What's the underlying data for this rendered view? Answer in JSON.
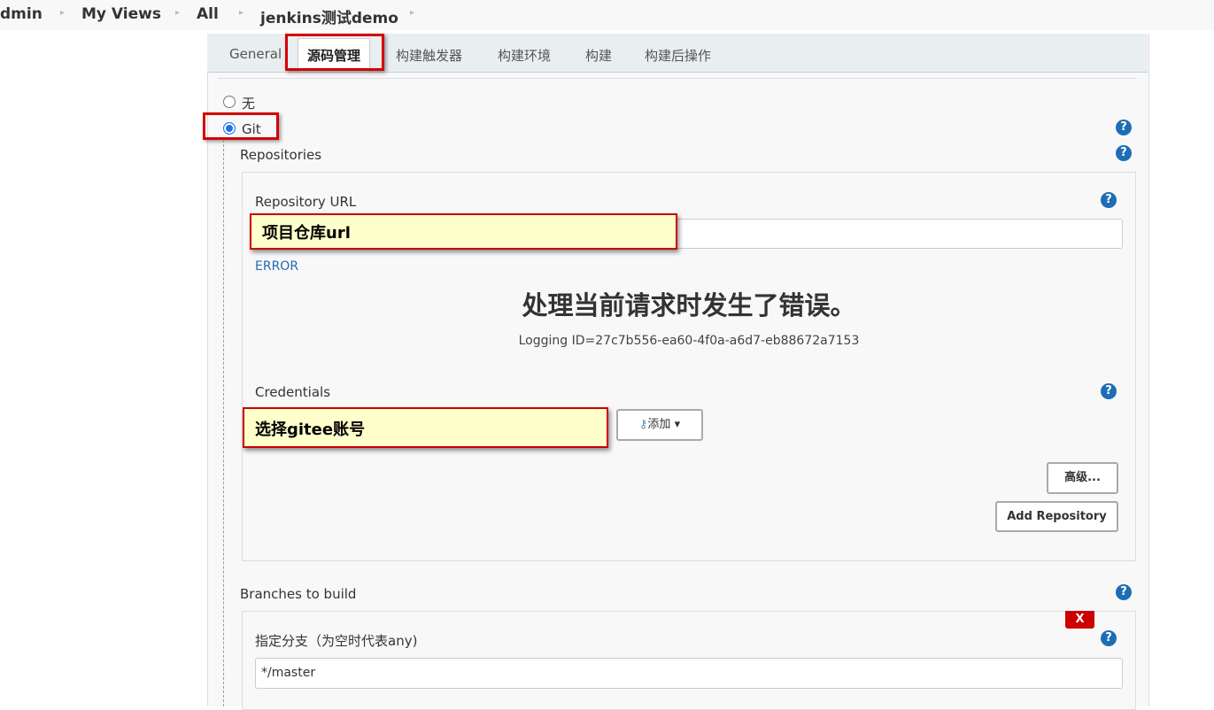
{
  "breadcrumbs": [
    "dmin",
    "My Views",
    "All",
    "jenkins测试demo"
  ],
  "tabs": [
    "General",
    "源码管理",
    "构建触发器",
    "构建环境",
    "构建",
    "构建后操作"
  ],
  "scm": {
    "none_label": "无",
    "git_label": "Git",
    "selected": "Git"
  },
  "repositories": {
    "title": "Repositories",
    "url_label": "Repository URL",
    "url_annotation": "项目仓库url",
    "error_label": "ERROR",
    "error_message": "处理当前请求时发生了错误。",
    "logging_id": "Logging ID=27c7b556-ea60-4f0a-a6d7-eb88672a7153",
    "credentials_label": "Credentials",
    "credentials_annotation": "选择gitee账号",
    "add_button": "添加",
    "advanced_button": "高级...",
    "add_repository_button": "Add Repository"
  },
  "branches": {
    "title": "Branches to build",
    "delete_button": "X",
    "specifier_label": "指定分支（为空时代表any)",
    "specifier_value": "*/master"
  },
  "help_icon": "?"
}
